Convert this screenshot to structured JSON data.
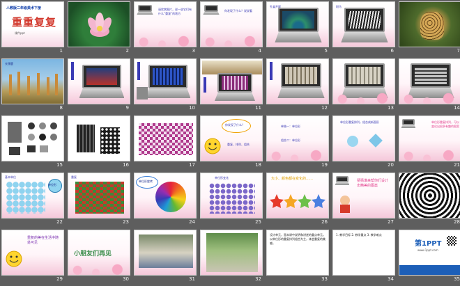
{
  "app": {
    "view": "slide-sorter"
  },
  "slides": [
    {
      "n": "1",
      "title_top": "人教版二年级美术下册",
      "title_main": "重重复复",
      "subtitle": "课件ppt"
    },
    {
      "n": "2"
    },
    {
      "n": "3",
      "text": "请欣赏图片，说一说它们有什么“重复”的地方"
    },
    {
      "n": "4",
      "text": "你发现了什么？说说看"
    },
    {
      "n": "5",
      "text": "孔雀开屏"
    },
    {
      "n": "6",
      "text": "斑马"
    },
    {
      "n": "7"
    },
    {
      "n": "8",
      "text": "长颈鹿"
    },
    {
      "n": "9"
    },
    {
      "n": "10"
    },
    {
      "n": "11"
    },
    {
      "n": "12"
    },
    {
      "n": "13"
    },
    {
      "n": "14"
    },
    {
      "n": "15"
    },
    {
      "n": "16"
    },
    {
      "n": "17"
    },
    {
      "n": "18",
      "bubble": "你发现了什么？",
      "caption": "重复、排列、组合"
    },
    {
      "n": "19",
      "line1": "单独一：单位形",
      "line2": "组合二：单位形"
    },
    {
      "n": "20",
      "text": "单位形重复排列，组合成新图形"
    },
    {
      "n": "21",
      "text": "单位形重复排列，可以变化出很多有趣的图案"
    },
    {
      "n": "22",
      "text": "基本单位",
      "label2": "单位形"
    },
    {
      "n": "23",
      "text": "重复"
    },
    {
      "n": "24",
      "text": "单位形旋转"
    },
    {
      "n": "25",
      "text": "单位形变化"
    },
    {
      "n": "26",
      "text": "大小、颜色都在变化的……"
    },
    {
      "n": "27",
      "text": "猜猜谁来帮你们设计出精美的图案"
    },
    {
      "n": "28"
    },
    {
      "n": "29",
      "text": "重复的美在生活中随处可见"
    },
    {
      "n": "30",
      "text": "小朋友们再见"
    },
    {
      "n": "31"
    },
    {
      "n": "32"
    },
    {
      "n": "33",
      "text": "设计单元，是本课中说明和讲述的重点单元。以单位形的重复排列组合为主，体会重复的美感。"
    },
    {
      "n": "34",
      "text": "1. 教学目标 2. 教学重点 3. 教学难点"
    },
    {
      "n": "35",
      "logo": "第1PPT",
      "sub": "www.1ppt.com"
    }
  ],
  "colors": {
    "workspace": "#5e5e5e",
    "number": "#f1f1f1",
    "accent_pink": "#f5c8da"
  }
}
